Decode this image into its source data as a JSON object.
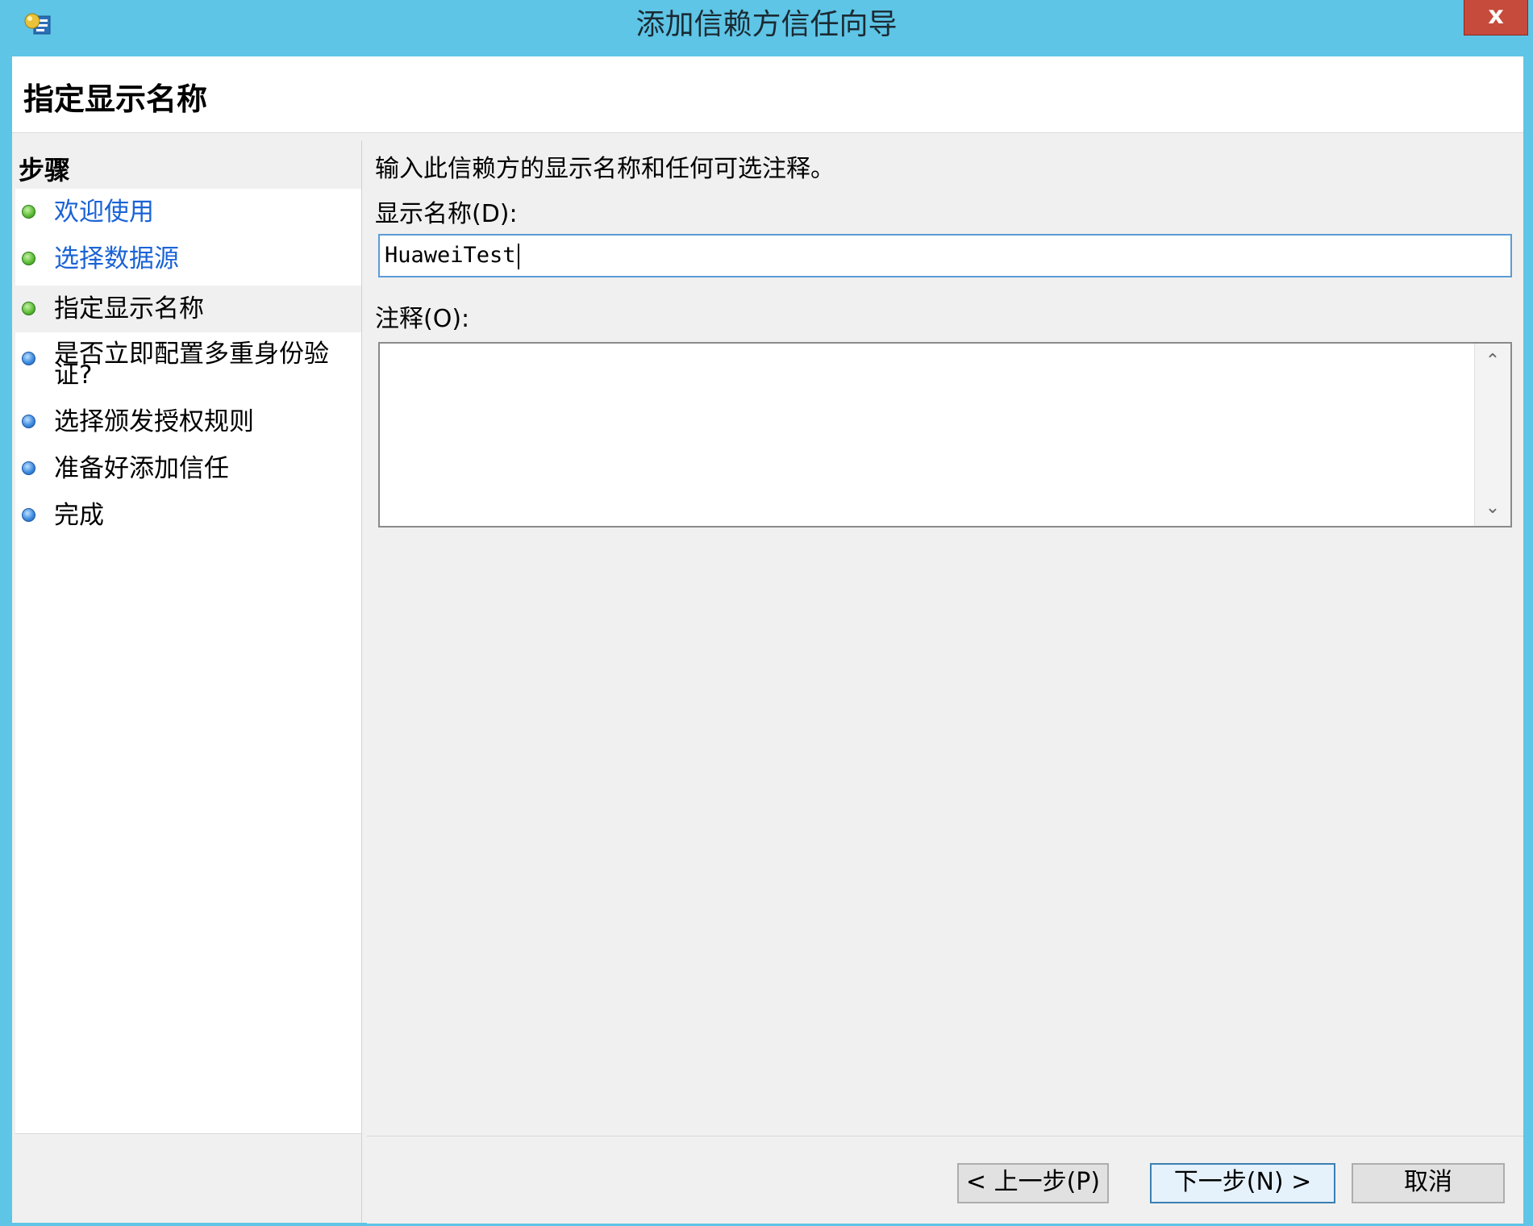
{
  "window": {
    "title": "添加信赖方信任向导",
    "close_label": "x",
    "app_icon": "adfs-wizard-icon",
    "accent_color": "#5ec5e6"
  },
  "header": {
    "page_title": "指定显示名称"
  },
  "steps": {
    "title": "步骤",
    "items": [
      {
        "label": "欢迎使用",
        "status": "green",
        "link": true
      },
      {
        "label": "选择数据源",
        "status": "green",
        "link": true
      },
      {
        "label": "指定显示名称",
        "status": "green",
        "current": true
      },
      {
        "label": "是否立即配置多重身份验证?",
        "status": "blue"
      },
      {
        "label": "选择颁发授权规则",
        "status": "blue"
      },
      {
        "label": "准备好添加信任",
        "status": "blue"
      },
      {
        "label": "完成",
        "status": "blue"
      }
    ]
  },
  "main": {
    "intro": "输入此信赖方的显示名称和任何可选注释。",
    "display_name_label": "显示名称(D):",
    "display_name_value": "HuaweiTest",
    "notes_label": "注释(O):",
    "notes_value": ""
  },
  "buttons": {
    "back": "< 上一步(P)",
    "next": "下一步(N) >",
    "cancel": "取消"
  }
}
